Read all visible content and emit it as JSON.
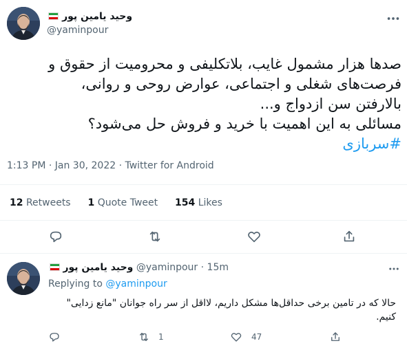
{
  "main_tweet": {
    "author_name": "وحید یامین پور",
    "author_handle": "@yaminpour",
    "text_lines": [
      "صدها هزار مشمول غایب، بلاتکلیفی و محرومیت از حقوق و",
      "فرصت‌های شغلی و اجتماعی، عوارض روحی و روانی،",
      "بالارفتن سن ازدواج و...",
      "مسائلی به این اهمیت با خرید و فروش حل می‌شود؟"
    ],
    "hashtag": "#سربازی",
    "timestamp": "1:13 PM · Jan 30, 2022 · Twitter for Android",
    "stats": {
      "retweets_count": "12",
      "retweets_label": "Retweets",
      "quote_count": "1",
      "quote_label": "Quote Tweet",
      "likes_count": "154",
      "likes_label": "Likes"
    }
  },
  "reply_tweet": {
    "author_name": "وحید یامین پور",
    "author_handle": "@yaminpour",
    "time": "· 15m",
    "replying_label": "Replying to",
    "replying_handle": "@yaminpour",
    "text": "حالا که در تامین برخی حداقل‌ها مشکل داریم، لااقل از سر راه جوانان \"مانع زدایی\" کنیم.",
    "retweet_count": "1",
    "like_count": "47"
  },
  "colors": {
    "accent": "#1d9bf0",
    "secondary_text": "#536471",
    "divider": "#eff3f4"
  },
  "icons": [
    "more-icon",
    "reply-icon",
    "retweet-icon",
    "like-icon",
    "share-icon",
    "flag-icon"
  ]
}
